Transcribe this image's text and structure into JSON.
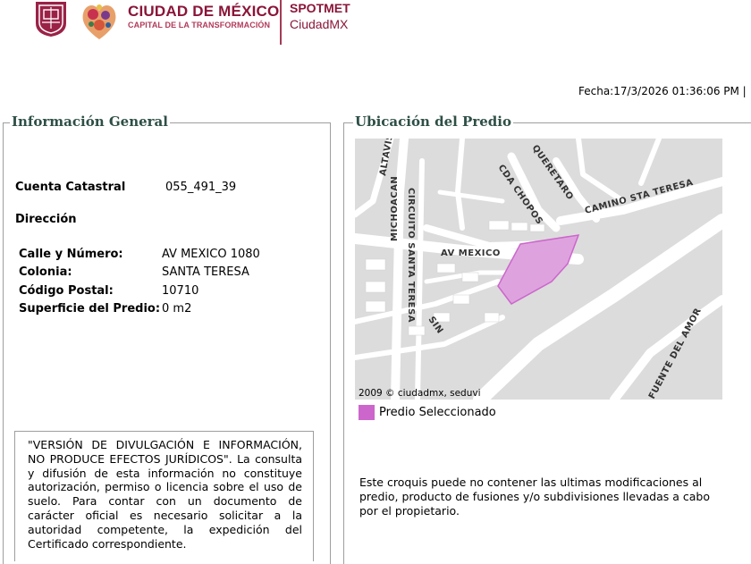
{
  "header": {
    "brand_title": "CIUDAD DE MÉXICO",
    "brand_subtitle": "CAPITAL DE LA TRANSFORMACIÓN",
    "app_name": "SPOTMET",
    "app_subname": "CiudadMX"
  },
  "fecha": "Fecha:17/3/2026 01:36:06 PM |",
  "info_general": {
    "legend": "Información General",
    "cuenta_label": "Cuenta Catastral",
    "cuenta_value": "055_491_39",
    "direccion_label": "Dirección",
    "fields": [
      {
        "label": "Calle y Número:",
        "value": "AV MEXICO 1080"
      },
      {
        "label": "Colonia:",
        "value": "SANTA TERESA"
      },
      {
        "label": "Código Postal:",
        "value": "10710"
      },
      {
        "label": "Superficie del Predio:",
        "value": "0 m2"
      }
    ],
    "disclaimer": "\"VERSIÓN DE DIVULGACIÓN E INFORMACIÓN, NO PRODUCE EFECTOS JURÍDICOS\". La consulta y difusión de esta información no constituye autorización, permiso o licencia sobre el uso de suelo. Para contar con un documento de carácter oficial es necesario solicitar a la autoridad competente, la expedición del Certificado correspondiente."
  },
  "ubicacion": {
    "legend": "Ubicación del Predio",
    "map_labels": {
      "altavista": "ALTAVISTA",
      "queretaro": "QUERETARO",
      "cda_chopos": "CDA CHOPOS",
      "camino": "CAMINO STA TERESA",
      "michoacan": "MICHOACAN",
      "circuito": "CIRCUITO SANTA TERESA",
      "av_mexico": "AV MEXICO",
      "sin": "SIN",
      "fuente": "FUENTE DEL AMOR"
    },
    "map_credit": "2009 © ciudadmx, seduvi",
    "legend_label": "Predio Seleccionado",
    "colors": {
      "predio": "#cc66cc",
      "map_bg": "#dcdcdc",
      "block": "#ffffff"
    },
    "note": "Este croquis puede no contener las ultimas modificaciones al predio, producto de fusiones y/o subdivisiones llevadas a cabo por el propietario."
  }
}
